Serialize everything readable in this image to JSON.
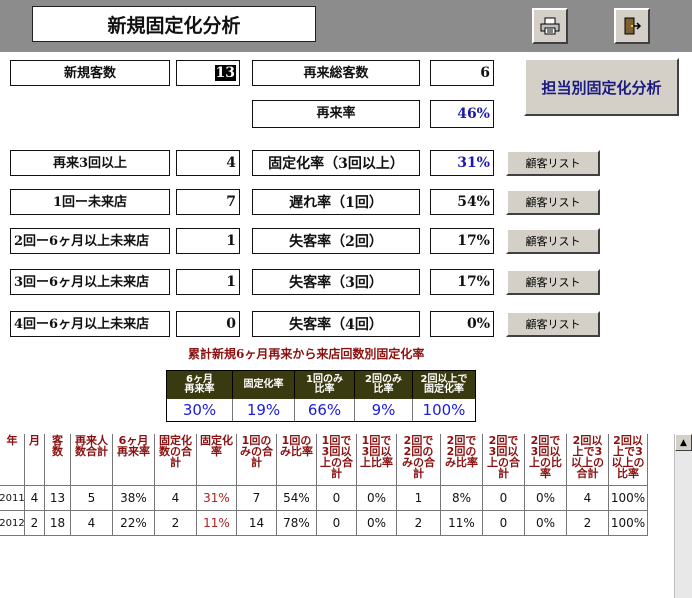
{
  "title": "新規固定化分析",
  "toolbar": {
    "print_icon": "printer-icon",
    "exit_icon": "exit-door-icon"
  },
  "stats": {
    "new_customers_label": "新規客数",
    "new_customers_value": "13",
    "return_total_label": "再来総客数",
    "return_total_value": "6",
    "return_rate_label": "再来率",
    "return_rate_value": "46%",
    "staff_analysis_button": "担当別固定化分析"
  },
  "rows": [
    {
      "label": "再来3回以上",
      "count": "4",
      "rate_label": "固定化率（3回以上）",
      "rate": "31%",
      "rate_blue": true,
      "button": "顧客リスト"
    },
    {
      "label": "1回ー未来店",
      "count": "7",
      "rate_label": "遅れ率（1回）",
      "rate": "54%",
      "rate_blue": false,
      "button": "顧客リスト"
    },
    {
      "label": "2回ー6ヶ月以上未来店",
      "count": "1",
      "rate_label": "失客率（2回）",
      "rate": "17%",
      "rate_blue": false,
      "button": "顧客リスト"
    },
    {
      "label": "3回ー6ヶ月以上未来店",
      "count": "1",
      "rate_label": "失客率（3回）",
      "rate": "17%",
      "rate_blue": false,
      "button": "顧客リスト"
    },
    {
      "label": "4回ー6ヶ月以上未来店",
      "count": "0",
      "rate_label": "失客率（4回）",
      "rate": "0%",
      "rate_blue": false,
      "button": "顧客リスト"
    }
  ],
  "caption": "累計新規6ヶ月再来から来店回数別固定化率",
  "summary": {
    "headers": [
      "6ヶ月\n再来率",
      "固定化率",
      "1回のみ\n比率",
      "2回のみ\n比率",
      "2回以上で\n固定化率"
    ],
    "values": [
      "30%",
      "19%",
      "66%",
      "9%",
      "100%"
    ]
  },
  "grid": {
    "headers": [
      "年",
      "月",
      "客\n数",
      "再来人\n数合計",
      "6ヶ月\n再来率",
      "固定化\n数の合\n計",
      "固定化\n率",
      "1回の\nみの合\n計",
      "1回の\nみ比率",
      "1回で\n3回以\n上の合\n計",
      "1回で\n3回以\n上比率",
      "2回で\n2回の\nみの合\n計",
      "2回で\n2回の\nみ比率",
      "2回で\n3回以\n上の合\n計",
      "2回で\n3回以\n上の比\n率",
      "2回以\n上で3\n以上の\n合計",
      "2回以\n上で3\n以上の\n比率"
    ],
    "rows": [
      [
        "2011",
        "4",
        "13",
        "5",
        "38%",
        "4",
        "31%",
        "7",
        "54%",
        "0",
        "0%",
        "1",
        "8%",
        "0",
        "0%",
        "4",
        "100%"
      ],
      [
        "2012",
        "2",
        "18",
        "4",
        "22%",
        "2",
        "11%",
        "14",
        "78%",
        "0",
        "0%",
        "2",
        "11%",
        "0",
        "0%",
        "2",
        "100%"
      ]
    ]
  }
}
